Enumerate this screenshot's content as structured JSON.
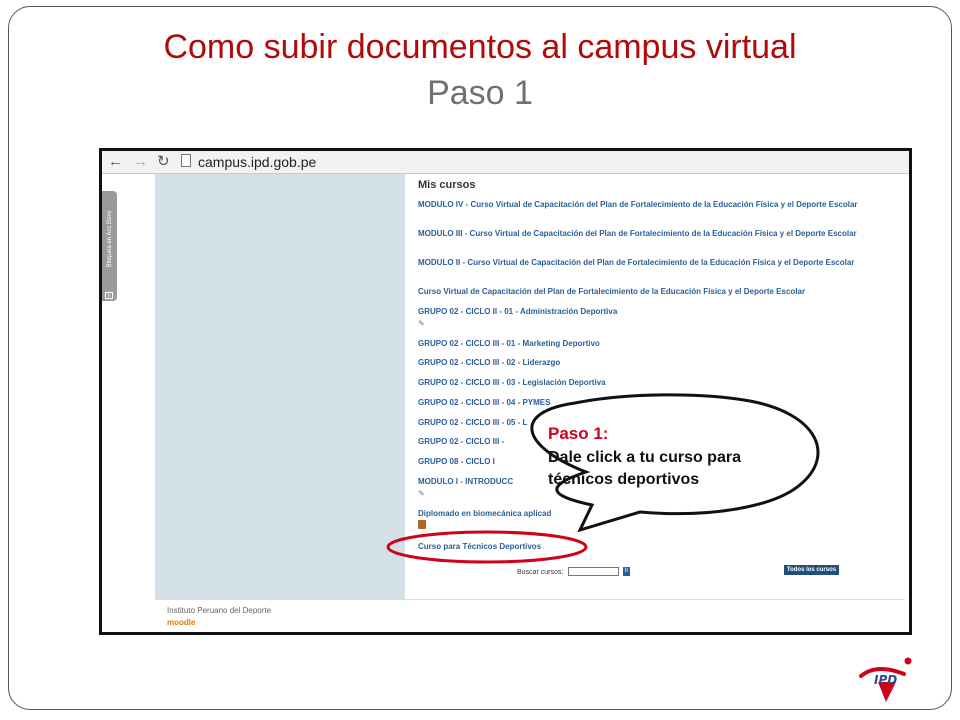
{
  "slide": {
    "title": "Como subir documentos al campus virtual",
    "subtitle": "Paso 1"
  },
  "browser": {
    "url": "campus.ipd.gob.pe",
    "back_icon": "arrow-left-icon",
    "forward_icon": "arrow-right-icon",
    "reload_icon": "reload-icon",
    "page_icon": "page-icon"
  },
  "side_tab": {
    "label": "Bloquea en Acc Boxs"
  },
  "mis_cursos": {
    "heading": "Mis cursos",
    "courses": [
      "MODULO IV - Curso Virtual de Capacitación del Plan de Fortalecimiento de la Educación Física y el Deporte Escolar",
      "MODULO III - Curso Virtual de Capacitación del Plan de Fortalecimiento de la Educación Física y el Deporte Escolar",
      "MODULO II - Curso Virtual de Capacitación del Plan de Fortalecimiento de la Educación Física y el Deporte Escolar",
      "Curso Virtual de Capacitación del Plan de Fortalecimiento de la Educación Física y el Deporte Escolar",
      "GRUPO 02 - CICLO II - 01 - Administración Deportiva",
      "GRUPO 02 - CICLO III - 01 - Marketing Deportivo",
      "GRUPO 02 - CICLO III - 02 - Liderazgo",
      "GRUPO 02 - CICLO III - 03 - Legislación Deportiva",
      "GRUPO 02 - CICLO III - 04 - PYMES",
      "GRUPO 02 - CICLO III - 05 - L",
      "GRUPO 02 - CICLO III -",
      "GRUPO 08 - CICLO I",
      "MODULO I - INTRODUCC",
      "Diplomado en biomecánica aplicad",
      "Curso para Técnicos Deportivos"
    ],
    "search_label": "Buscar cursos:",
    "search_value": "",
    "search_button": "Ir",
    "all_courses_button": "Todos los cursos"
  },
  "footer": {
    "institution": "Instituto Peruano del Deporte",
    "logo_text": "moodle"
  },
  "callout": {
    "title": "Paso 1:",
    "line1": "Dale click a tu curso para",
    "line2": "técnicos deportivos"
  },
  "logo": {
    "text": "IPD"
  },
  "colors": {
    "title": "#b00a0a",
    "subtitle": "#707070",
    "link": "#2b5e99",
    "highlight": "#d0021b"
  }
}
